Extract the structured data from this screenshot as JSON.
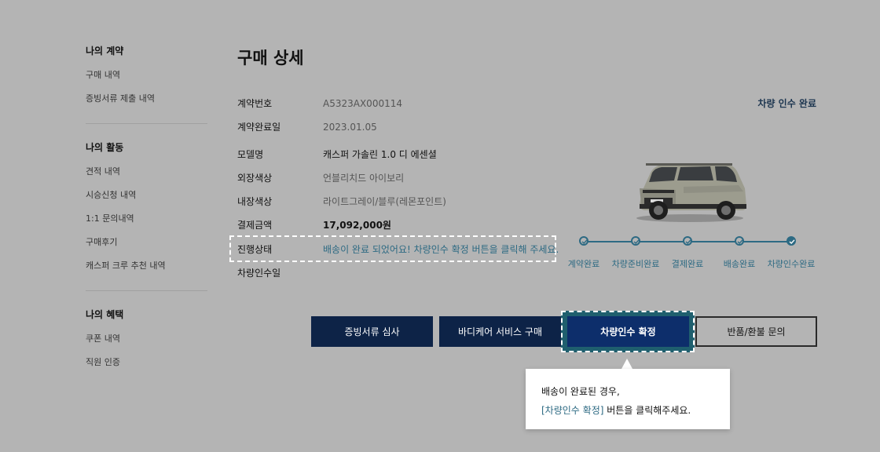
{
  "sidebar": {
    "groups": [
      {
        "title": "나의 계약",
        "items": [
          "구매 내역",
          "증빙서류 제출 내역"
        ]
      },
      {
        "title": "나의 활동",
        "items": [
          "견적 내역",
          "시승신청 내역",
          "1:1 문의내역",
          "구매후기",
          "캐스퍼 크루 추천 내역"
        ]
      },
      {
        "title": "나의 혜택",
        "items": [
          "쿠폰 내역",
          "직원 인증"
        ]
      }
    ]
  },
  "page": {
    "title": "구매 상세"
  },
  "info": {
    "contract_no_label": "계약번호",
    "contract_no": "A5323AX000114",
    "contract_date_label": "계약완료일",
    "contract_date": "2023.01.05",
    "model_label": "모델명",
    "model": "캐스퍼 가솔린 1.0 디 에센셜",
    "exterior_label": "외장색상",
    "exterior": "언블리치드 아이보리",
    "interior_label": "내장색상",
    "interior": "라이트그레이/블루(레몬포인트)",
    "price_label": "결제금액",
    "price": "17,092,000원",
    "progress_label": "진행상태",
    "progress": "배송이 완료 되었어요! 차량인수 확정 버튼을 클릭해 주세요.",
    "delivery_label": "차량인수일"
  },
  "vehicle_status": "차량 인수 완료",
  "progress_steps": {
    "labels": [
      "계약완료",
      "차량준비완료",
      "결제완료",
      "배송완료",
      "차량인수완료"
    ]
  },
  "buttons": {
    "docs_review": "증빙서류 심사",
    "bodycare": "바디케어 서비스 구매",
    "confirm": "차량인수 확정",
    "refund": "반품/환불 문의"
  },
  "tooltip": {
    "line1": "배송이 완료된 경우,",
    "line2_accent": "[차량인수 확정]",
    "line2_rest": " 버튼을 클릭해주세요."
  },
  "colors": {
    "background": "#b4b4b4",
    "accent": "#2d6a83",
    "navy": "#0d2347",
    "highlight": "#1f5f6e"
  }
}
